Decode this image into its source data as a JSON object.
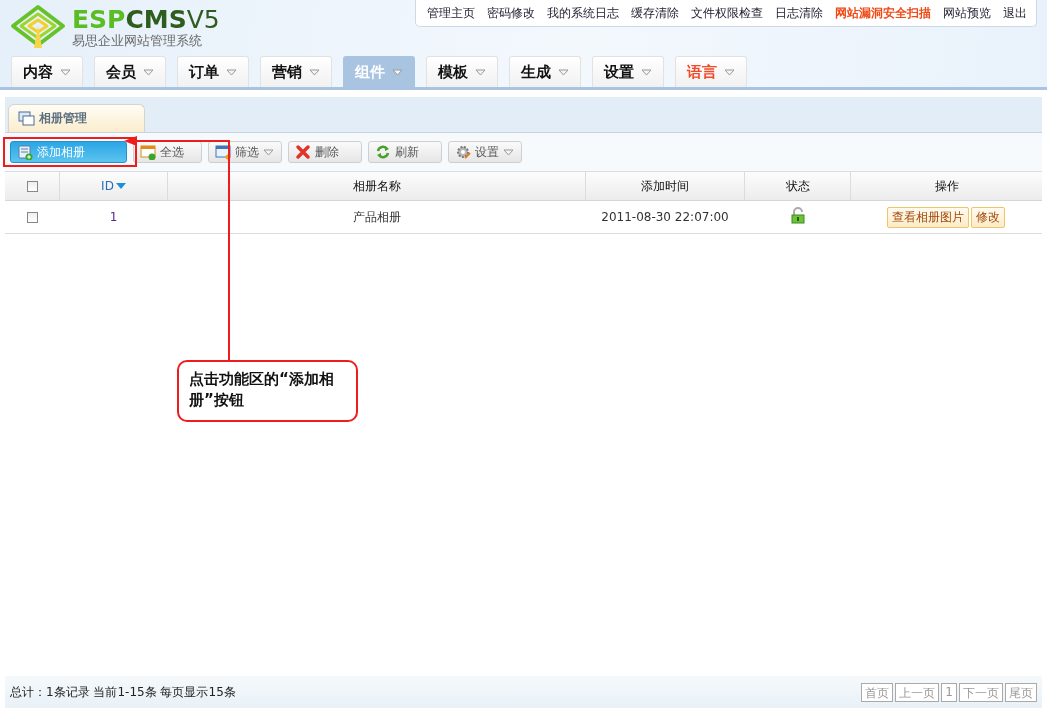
{
  "logo": {
    "brand": [
      "ESP",
      "CMS"
    ],
    "version": "V5",
    "subtitle": "易思企业网站管理系统"
  },
  "top_links": [
    {
      "label": "管理主页",
      "highlight": false
    },
    {
      "label": "密码修改",
      "highlight": false
    },
    {
      "label": "我的系统日志",
      "highlight": false
    },
    {
      "label": "缓存清除",
      "highlight": false
    },
    {
      "label": "文件权限检查",
      "highlight": false
    },
    {
      "label": "日志清除",
      "highlight": false
    },
    {
      "label": "网站漏洞安全扫描",
      "highlight": true
    },
    {
      "label": "网站预览",
      "highlight": false
    },
    {
      "label": "退出",
      "highlight": false
    }
  ],
  "nav_tabs": [
    {
      "label": "内容",
      "selected": false,
      "highlight": false
    },
    {
      "label": "会员",
      "selected": false,
      "highlight": false
    },
    {
      "label": "订单",
      "selected": false,
      "highlight": false
    },
    {
      "label": "营销",
      "selected": false,
      "highlight": false
    },
    {
      "label": "组件",
      "selected": true,
      "highlight": false
    },
    {
      "label": "模板",
      "selected": false,
      "highlight": false
    },
    {
      "label": "生成",
      "selected": false,
      "highlight": false
    },
    {
      "label": "设置",
      "selected": false,
      "highlight": false
    },
    {
      "label": "语言",
      "selected": false,
      "highlight": true
    }
  ],
  "page_tab": {
    "label": "相册管理"
  },
  "toolbar": [
    {
      "label": "添加相册",
      "kind": "add",
      "primary": true,
      "dropdown": false
    },
    {
      "label": "全选",
      "kind": "select",
      "primary": false,
      "dropdown": false
    },
    {
      "label": "筛选",
      "kind": "filter",
      "primary": false,
      "dropdown": true
    },
    {
      "label": "删除",
      "kind": "delete",
      "primary": false,
      "dropdown": false
    },
    {
      "label": "刷新",
      "kind": "refresh",
      "primary": false,
      "dropdown": false
    },
    {
      "label": "设置",
      "kind": "settings",
      "primary": false,
      "dropdown": true
    }
  ],
  "table": {
    "columns": [
      {
        "kind": "check",
        "checked": false
      },
      {
        "kind": "text",
        "label": "ID",
        "sorted": true
      },
      {
        "kind": "text",
        "label": "相册名称",
        "sorted": false
      },
      {
        "kind": "text",
        "label": "添加时间",
        "sorted": false
      },
      {
        "kind": "text",
        "label": "状态",
        "sorted": false
      },
      {
        "kind": "text",
        "label": "操作",
        "sorted": false
      }
    ],
    "rows": [
      {
        "checked": false,
        "id": "1",
        "name": "产品相册",
        "time": "2011-08-30 22:07:00",
        "locked": false,
        "actions": [
          "查看相册图片",
          "修改"
        ]
      }
    ]
  },
  "footer": {
    "summary": "总计：1条记录 当前1-15条 每页显示15条",
    "pager": [
      "首页",
      "上一页",
      "1",
      "下一页",
      "尾页"
    ]
  },
  "annotation": {
    "text": "点击功能区的“添加相册”按钮"
  }
}
